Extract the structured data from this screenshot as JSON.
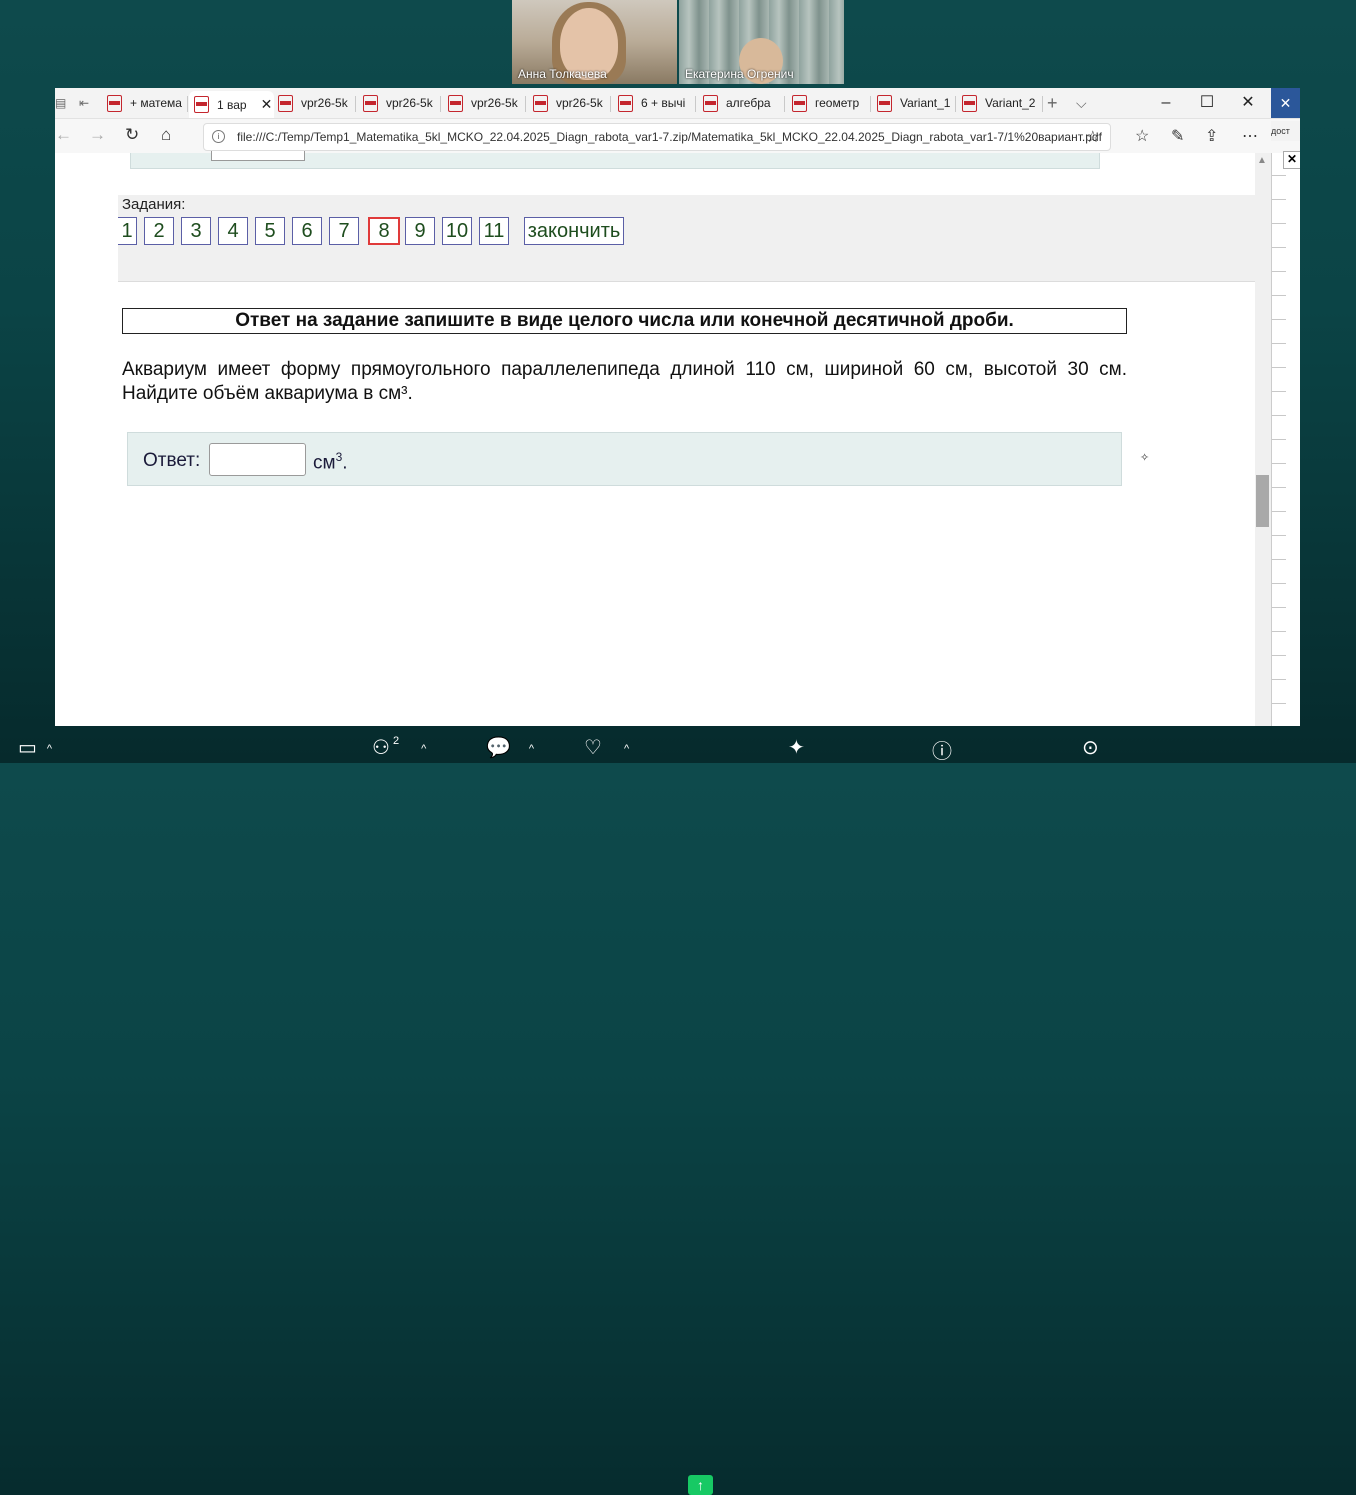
{
  "participants": [
    {
      "name": "Анна Толкачева"
    },
    {
      "name": "Екатерина Огренич"
    }
  ],
  "browser": {
    "tabs": [
      {
        "label": "+ матема"
      },
      {
        "label": "1 вар",
        "active": true
      },
      {
        "label": "vpr26-5k"
      },
      {
        "label": "vpr26-5k"
      },
      {
        "label": "vpr26-5k"
      },
      {
        "label": "vpr26-5k"
      },
      {
        "label": "6 + вычі"
      },
      {
        "label": "алгебра"
      },
      {
        "label": "геометр"
      },
      {
        "label": "Variant_1"
      },
      {
        "label": "Variant_2"
      }
    ],
    "new_tab": "+",
    "tab_list": "⌵",
    "close_tab": "✕",
    "url": "file:///C:/Temp/Temp1_Matematika_5kl_MCKO_22.04.2025_Diagn_rabota_var1-7.zip/Matematika_5kl_MCKO_22.04.2025_Diagn_rabota_var1-7/1%20вариант.pdf",
    "side_text": "дост"
  },
  "tasks": {
    "label": "Задания:",
    "numbers": [
      "1",
      "2",
      "3",
      "4",
      "5",
      "6",
      "7",
      "8",
      "9",
      "10",
      "11"
    ],
    "current": "8",
    "finish_label": "закончить"
  },
  "instruction": "Ответ на задание запишите в виде целого числа или конечной десятичной дроби.",
  "problem_text": "Аквариум имеет форму прямоугольного параллелепипеда длиной 110 см, шириной 60 см, высотой 30 см. Найдите объём аквариума в см³.",
  "answer": {
    "label": "Ответ:",
    "value": "",
    "unit": "см",
    "unit_power": "3",
    "suffix": "."
  },
  "toolbar": {
    "participants_count": "2"
  }
}
